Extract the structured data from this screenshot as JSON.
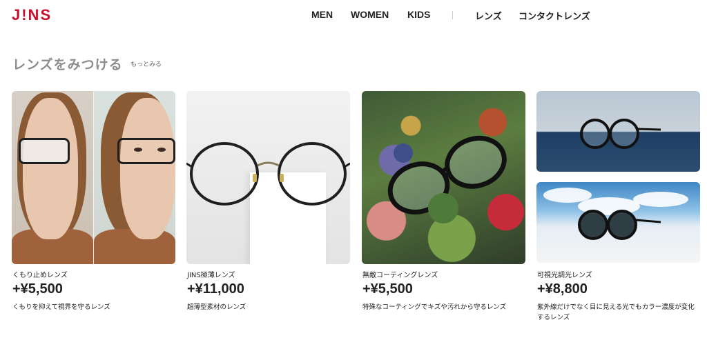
{
  "header": {
    "logo": "J!NS",
    "nav": [
      "MEN",
      "WOMEN",
      "KIDS",
      "レンズ",
      "コンタクトレンズ"
    ]
  },
  "section": {
    "title": "レンズをみつける",
    "more": "もっとみる"
  },
  "cards": [
    {
      "name": "くもり止めレンズ",
      "price": "+¥5,500",
      "desc": "くもりを抑えて視界を守るレンズ"
    },
    {
      "name": "JINS極薄レンズ",
      "price": "+¥11,000",
      "desc": "超薄型素材のレンズ"
    },
    {
      "name": "無敵コーティングレンズ",
      "price": "+¥5,500",
      "desc": "特殊なコーティングでキズや汚れから守るレンズ"
    },
    {
      "name": "可視光調光レンズ",
      "price": "+¥8,800",
      "desc": "紫外線だけでなく目に見える光でもカラー濃度が変化するレンズ"
    }
  ],
  "colors": {
    "brand": "#c8102e",
    "heading": "#8c8c8c",
    "text": "#222222"
  },
  "icons": {
    "logo": "jins-logo"
  }
}
